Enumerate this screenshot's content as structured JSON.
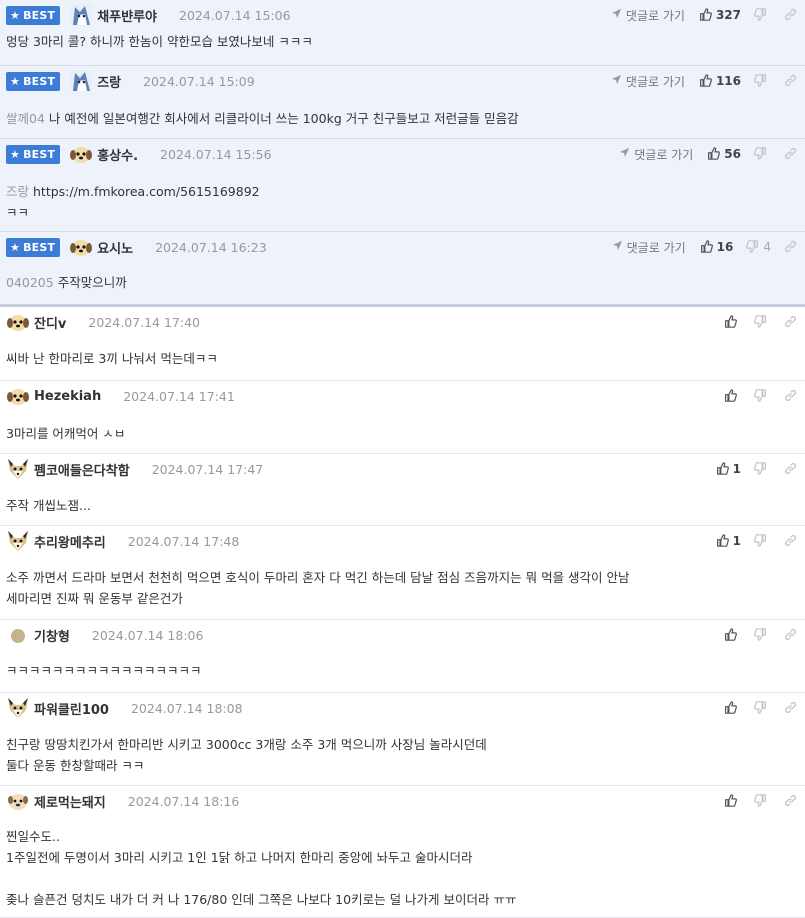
{
  "labels": {
    "best": "BEST",
    "reply": "댓글로 가기"
  },
  "colors": {
    "best_bg": "#eef2fb",
    "badge": "#3c7bd6"
  },
  "comments": [
    {
      "best": true,
      "avatar": "wolf",
      "nick": "채푸뱐루야",
      "time": "2024.07.14 15:06",
      "reply_to": "",
      "lines": [
        "멍당 3마리 콜? 하니까 한놈이 약한모습 보였나보네 ㅋㅋㅋ"
      ],
      "up": "327",
      "down": ""
    },
    {
      "best": true,
      "avatar": "wolf",
      "nick": "즈랑",
      "time": "2024.07.14 15:09",
      "reply_to": "쌀께04",
      "lines": [
        "나 예전에 일본여행간 회사에서 리클라이너 쓰는 100kg 거구 친구들보고 저런글들 믿음감"
      ],
      "up": "116",
      "down": ""
    },
    {
      "best": true,
      "avatar": "puppy",
      "nick": "홍상수.",
      "time": "2024.07.14 15:56",
      "reply_to": "즈랑",
      "lines": [
        "https://m.fmkorea.com/5615169892",
        "ㅋㅋ"
      ],
      "up": "56",
      "down": ""
    },
    {
      "best": true,
      "avatar": "puppy",
      "nick": "요시노",
      "time": "2024.07.14 16:23",
      "reply_to": "040205",
      "lines": [
        "주작맞으니까"
      ],
      "up": "16",
      "down": "4"
    },
    {
      "best": false,
      "avatar": "puppy",
      "nick": "잔디v",
      "time": "2024.07.14 17:40",
      "reply_to": "",
      "lines": [
        "씨바 난 한마리로 3끼 나눠서 먹는데ㅋㅋ"
      ],
      "up": "",
      "down": ""
    },
    {
      "best": false,
      "avatar": "puppy",
      "nick": "Hezekiah",
      "time": "2024.07.14 17:41",
      "reply_to": "",
      "lines": [
        "3마리를 어캐먹어 ㅅㅂ"
      ],
      "up": "",
      "down": ""
    },
    {
      "best": false,
      "avatar": "fox",
      "nick": "펨코애들은다착함",
      "time": "2024.07.14 17:47",
      "reply_to": "",
      "lines": [
        "주작 개씹노잼..."
      ],
      "up": "1",
      "down": ""
    },
    {
      "best": false,
      "avatar": "fox",
      "nick": "추리왕메추리",
      "time": "2024.07.14 17:48",
      "reply_to": "",
      "lines": [
        "소주 까면서 드라마 보면서 천천히 먹으면 호식이 두마리 혼자 다 먹긴 하는데 담날 점심 즈음까지는 뭐 먹을 생각이 안남",
        "세마리면 진짜 뭐 운동부 같은건가"
      ],
      "up": "1",
      "down": ""
    },
    {
      "best": false,
      "avatar": "dot",
      "nick": "기창형",
      "time": "2024.07.14 18:06",
      "reply_to": "",
      "lines": [
        "ㅋㅋㅋㅋㅋㅋㅋㅋㅋㅋㅋㅋㅋㅋㅋㅋㅋ"
      ],
      "up": "",
      "down": ""
    },
    {
      "best": false,
      "avatar": "fox",
      "nick": "파워클린100",
      "time": "2024.07.14 18:08",
      "reply_to": "",
      "lines": [
        "친구랑 땅땅치킨가서 한마리반 시키고 3000cc 3개랑 소주 3개 먹으니까 사장님 놀라시던데",
        "둘다 운동 한창할때라 ㅋㅋ"
      ],
      "up": "",
      "down": ""
    },
    {
      "best": false,
      "avatar": "pig",
      "nick": "제로먹는돼지",
      "time": "2024.07.14 18:16",
      "reply_to": "",
      "lines": [
        "찐일수도..",
        "1주일전에 두명이서 3마리 시키고 1인 1닭 하고 나머지 한마리 중앙에 놔두고 술마시더라",
        "",
        "좆나 슬픈건 덩치도 내가 더 커 나 176/80 인데 그쪽은 나보다 10키로는 덜 나가게 보이더라 ㅠㅠ"
      ],
      "up": "",
      "down": ""
    }
  ]
}
